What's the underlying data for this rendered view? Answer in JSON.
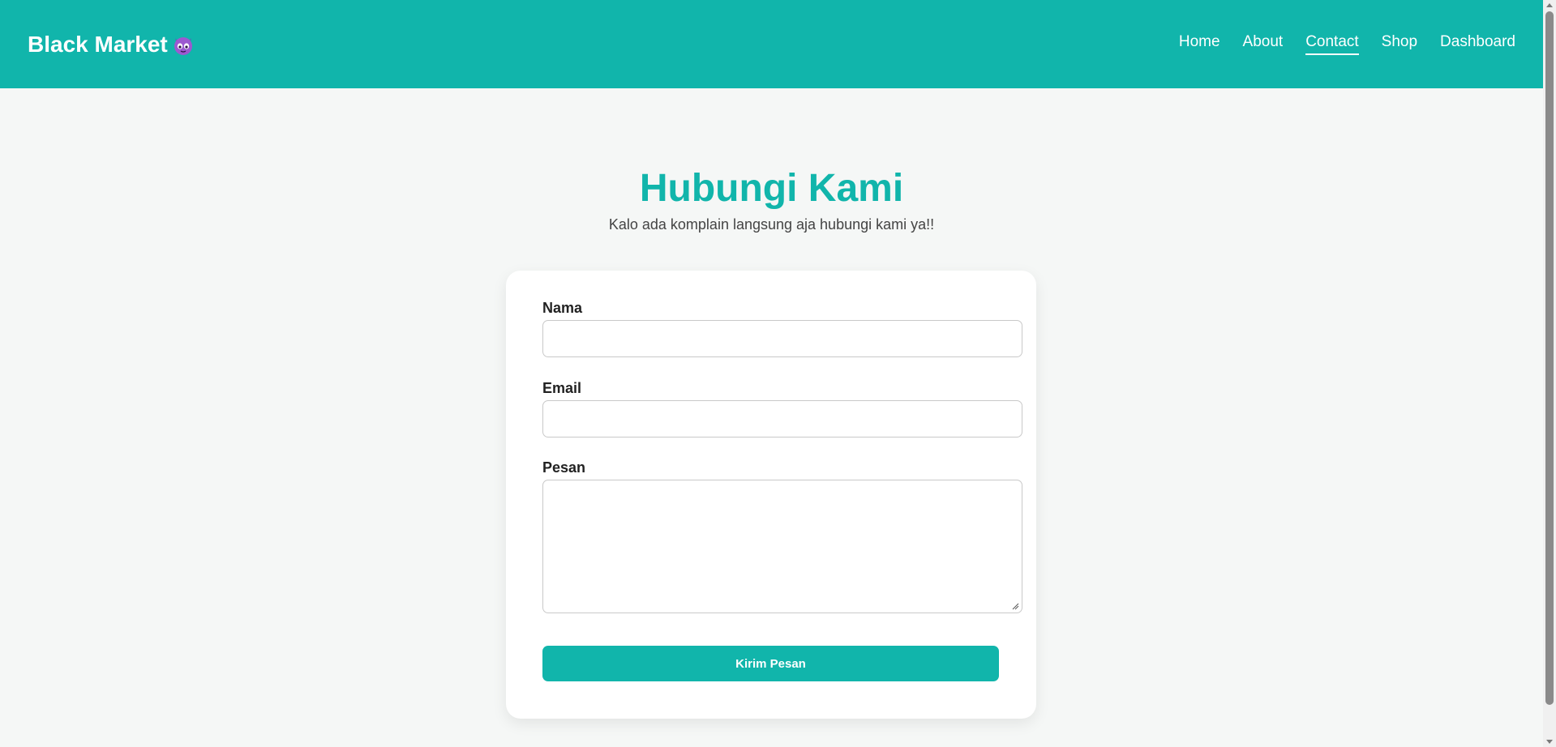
{
  "header": {
    "brand": "Black Market",
    "brand_icon": "devil-emoji-icon",
    "nav": [
      {
        "label": "Home",
        "active": false
      },
      {
        "label": "About",
        "active": false
      },
      {
        "label": "Contact",
        "active": true
      },
      {
        "label": "Shop",
        "active": false
      },
      {
        "label": "Dashboard",
        "active": false
      }
    ]
  },
  "hero": {
    "title": "Hubungi Kami",
    "subtitle": "Kalo ada komplain langsung aja hubungi kami ya!!"
  },
  "form": {
    "name_label": "Nama",
    "name_value": "",
    "email_label": "Email",
    "email_value": "",
    "message_label": "Pesan",
    "message_value": "",
    "submit_label": "Kirim Pesan"
  },
  "colors": {
    "accent": "#11b5ab",
    "background": "#f5f7f6",
    "card": "#ffffff"
  }
}
